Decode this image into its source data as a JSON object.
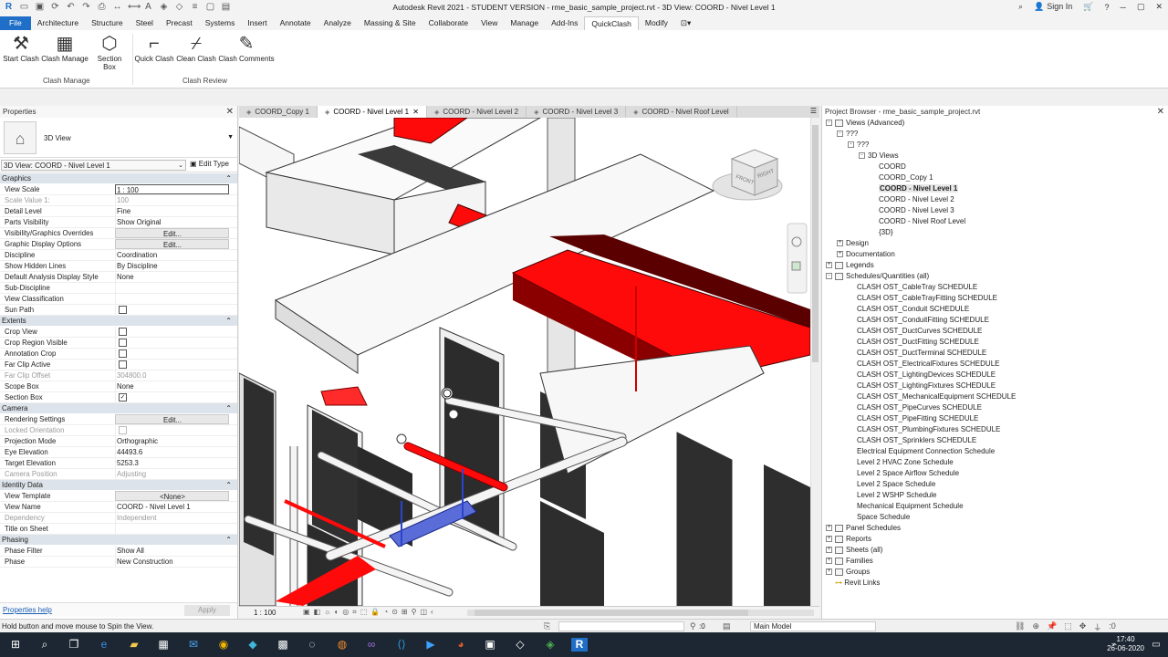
{
  "window": {
    "title": "Autodesk Revit 2021 - STUDENT VERSION - rme_basic_sample_project.rvt - 3D View: COORD - Nivel Level 1",
    "sign_in": "Sign In"
  },
  "menu": {
    "items": [
      "File",
      "Architecture",
      "Structure",
      "Steel",
      "Precast",
      "Systems",
      "Insert",
      "Annotate",
      "Analyze",
      "Massing & Site",
      "Collaborate",
      "View",
      "Manage",
      "Add-Ins",
      "QuickClash",
      "Modify"
    ],
    "active": "QuickClash"
  },
  "ribbon": {
    "buttons": [
      "Start Clash",
      "Clash Manage",
      "Section Box",
      "Quick Clash",
      "Clean Clash",
      "Clash Comments"
    ],
    "panels": [
      "Clash Manage",
      "Clash Review"
    ]
  },
  "properties": {
    "title": "Properties",
    "type_name": "3D View",
    "instance": "3D View: COORD - Nivel Level 1",
    "edit_type": "Edit Type",
    "help": "Properties help",
    "apply": "Apply",
    "groups": [
      {
        "name": "Graphics",
        "rows": [
          {
            "k": "View Scale",
            "v": "1 : 100",
            "style": "edit"
          },
          {
            "k": "Scale Value    1:",
            "v": "100",
            "dis": true
          },
          {
            "k": "Detail Level",
            "v": "Fine"
          },
          {
            "k": "Parts Visibility",
            "v": "Show Original"
          },
          {
            "k": "Visibility/Graphics Overrides",
            "v": "Edit...",
            "style": "btn"
          },
          {
            "k": "Graphic Display Options",
            "v": "Edit...",
            "style": "btn"
          },
          {
            "k": "Discipline",
            "v": "Coordination"
          },
          {
            "k": "Show Hidden Lines",
            "v": "By Discipline"
          },
          {
            "k": "Default Analysis Display Style",
            "v": "None"
          },
          {
            "k": "Sub-Discipline",
            "v": ""
          },
          {
            "k": "View Classification",
            "v": ""
          },
          {
            "k": "Sun Path",
            "v": "",
            "cb": "off"
          }
        ]
      },
      {
        "name": "Extents",
        "rows": [
          {
            "k": "Crop View",
            "v": "",
            "cb": "off"
          },
          {
            "k": "Crop Region Visible",
            "v": "",
            "cb": "off"
          },
          {
            "k": "Annotation Crop",
            "v": "",
            "cb": "off"
          },
          {
            "k": "Far Clip Active",
            "v": "",
            "cb": "off"
          },
          {
            "k": "Far Clip Offset",
            "v": "304800.0",
            "dis": true
          },
          {
            "k": "Scope Box",
            "v": "None"
          },
          {
            "k": "Section Box",
            "v": "",
            "cb": "on"
          }
        ]
      },
      {
        "name": "Camera",
        "rows": [
          {
            "k": "Rendering Settings",
            "v": "Edit...",
            "style": "btn"
          },
          {
            "k": "Locked Orientation",
            "v": "",
            "cb": "dis",
            "dis": true
          },
          {
            "k": "Projection Mode",
            "v": "Orthographic"
          },
          {
            "k": "Eye Elevation",
            "v": "44493.6"
          },
          {
            "k": "Target Elevation",
            "v": "5253.3"
          },
          {
            "k": "Camera Position",
            "v": "Adjusting",
            "dis": true
          }
        ]
      },
      {
        "name": "Identity Data",
        "rows": [
          {
            "k": "View Template",
            "v": "<None>",
            "style": "btn"
          },
          {
            "k": "View Name",
            "v": "COORD - Nivel Level 1"
          },
          {
            "k": "Dependency",
            "v": "Independent",
            "dis": true
          },
          {
            "k": "Title on Sheet",
            "v": ""
          }
        ]
      },
      {
        "name": "Phasing",
        "rows": [
          {
            "k": "Phase Filter",
            "v": "Show All"
          },
          {
            "k": "Phase",
            "v": "New Construction"
          }
        ]
      }
    ]
  },
  "tabs": [
    "COORD_Copy 1",
    "COORD - Nivel Level 1",
    "COORD - Nivel Level 2",
    "COORD - Nivel Level 3",
    "COORD - Nivel Roof Level"
  ],
  "active_tab": 1,
  "viewcube": {
    "front": "FRONT",
    "right": "RIGHT"
  },
  "view_scale_label": "1 : 100",
  "browser": {
    "title": "Project Browser - rme_basic_sample_project.rvt",
    "nodes": [
      {
        "t": "Views (Advanced)",
        "lv": 0,
        "tg": "-",
        "fi": true
      },
      {
        "t": "???",
        "lv": 1,
        "tg": "-"
      },
      {
        "t": "???",
        "lv": 2,
        "tg": "-"
      },
      {
        "t": "3D Views",
        "lv": 3,
        "tg": "-"
      },
      {
        "t": "COORD",
        "lv": 4
      },
      {
        "t": "COORD_Copy 1",
        "lv": 4
      },
      {
        "t": "COORD - Nivel Level 1",
        "lv": 4,
        "sel": true
      },
      {
        "t": "COORD - Nivel Level 2",
        "lv": 4
      },
      {
        "t": "COORD - Nivel Level 3",
        "lv": 4
      },
      {
        "t": "COORD - Nivel Roof Level",
        "lv": 4
      },
      {
        "t": "{3D}",
        "lv": 4
      },
      {
        "t": "Design",
        "lv": 1,
        "tg": "+"
      },
      {
        "t": "Documentation",
        "lv": 1,
        "tg": "+"
      },
      {
        "t": "Legends",
        "lv": 0,
        "tg": "+",
        "fi": true
      },
      {
        "t": "Schedules/Quantities (all)",
        "lv": 0,
        "tg": "-",
        "fi": true
      },
      {
        "t": "CLASH OST_CableTray SCHEDULE",
        "lv": 2
      },
      {
        "t": "CLASH OST_CableTrayFitting SCHEDULE",
        "lv": 2
      },
      {
        "t": "CLASH OST_Conduit SCHEDULE",
        "lv": 2
      },
      {
        "t": "CLASH OST_ConduitFitting SCHEDULE",
        "lv": 2
      },
      {
        "t": "CLASH OST_DuctCurves SCHEDULE",
        "lv": 2
      },
      {
        "t": "CLASH OST_DuctFitting SCHEDULE",
        "lv": 2
      },
      {
        "t": "CLASH OST_DuctTerminal SCHEDULE",
        "lv": 2
      },
      {
        "t": "CLASH OST_ElectricalFixtures SCHEDULE",
        "lv": 2
      },
      {
        "t": "CLASH OST_LightingDevices SCHEDULE",
        "lv": 2
      },
      {
        "t": "CLASH OST_LightingFixtures SCHEDULE",
        "lv": 2
      },
      {
        "t": "CLASH OST_MechanicalEquipment SCHEDULE",
        "lv": 2
      },
      {
        "t": "CLASH OST_PipeCurves SCHEDULE",
        "lv": 2
      },
      {
        "t": "CLASH OST_PipeFitting SCHEDULE",
        "lv": 2
      },
      {
        "t": "CLASH OST_PlumbingFixtures SCHEDULE",
        "lv": 2
      },
      {
        "t": "CLASH OST_Sprinklers SCHEDULE",
        "lv": 2
      },
      {
        "t": "Electrical Equipment Connection Schedule",
        "lv": 2
      },
      {
        "t": "Level 2 HVAC Zone Schedule",
        "lv": 2
      },
      {
        "t": "Level 2 Space Airflow Schedule",
        "lv": 2
      },
      {
        "t": "Level 2 Space Schedule",
        "lv": 2
      },
      {
        "t": "Level 2 WSHP Schedule",
        "lv": 2
      },
      {
        "t": "Mechanical Equipment Schedule",
        "lv": 2
      },
      {
        "t": "Space Schedule",
        "lv": 2
      },
      {
        "t": "Panel Schedules",
        "lv": 0,
        "tg": "+",
        "fi": true
      },
      {
        "t": "Reports",
        "lv": 0,
        "tg": "+",
        "fi": true
      },
      {
        "t": "Sheets (all)",
        "lv": 0,
        "tg": "+",
        "fi": true
      },
      {
        "t": "Families",
        "lv": 0,
        "tg": "+",
        "fi": true
      },
      {
        "t": "Groups",
        "lv": 0,
        "tg": "+",
        "fi": true
      },
      {
        "t": "Revit Links",
        "lv": 0,
        "link": true
      }
    ]
  },
  "status": {
    "hint": "Hold button and move mouse to Spin the View.",
    "zero": ":0",
    "model": "Main Model"
  },
  "clock": {
    "time": "17:40",
    "date": "26-06-2020"
  },
  "colors": {
    "accent": "#1f6fc8",
    "clash_red": "#ff0a0a",
    "ribbon_bg": "#ffffff"
  }
}
